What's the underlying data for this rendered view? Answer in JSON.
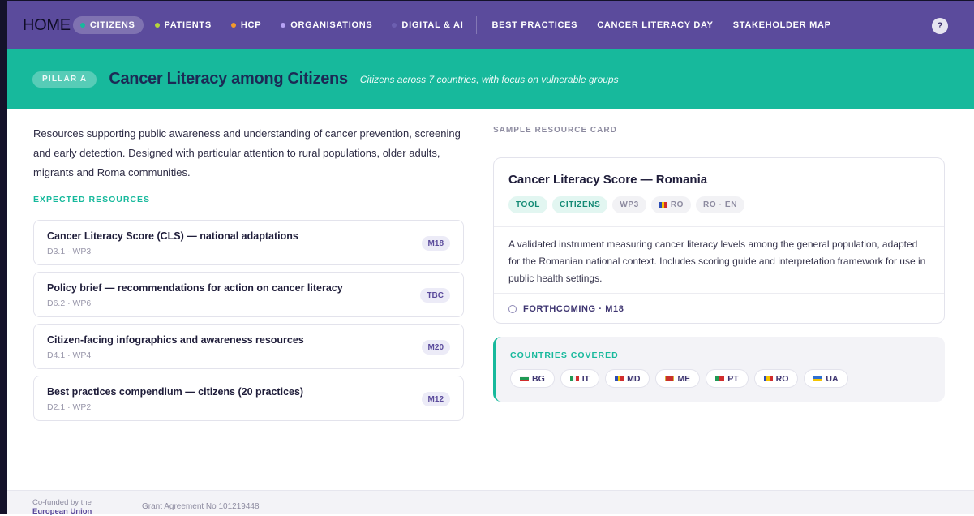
{
  "nav": {
    "home": "HOME",
    "items": [
      {
        "label": "CITIZENS",
        "dot": "#17b99c",
        "active": true
      },
      {
        "label": "PATIENTS",
        "dot": "#b6d53a"
      },
      {
        "label": "HCP",
        "dot": "#f39a2b"
      },
      {
        "label": "ORGANISATIONS",
        "dot": "#b7a3f5"
      },
      {
        "label": "DIGITAL & AI",
        "dot": "#6c5fb0"
      }
    ],
    "links": [
      "BEST PRACTICES",
      "CANCER LITERACY DAY",
      "STAKEHOLDER MAP"
    ],
    "help": "?"
  },
  "hero": {
    "pillar": "PILLAR A",
    "title": "Cancer Literacy among Citizens",
    "subtitle": "Citizens across 7 countries, with focus on vulnerable groups"
  },
  "intro": "Resources supporting public awareness and understanding of cancer prevention, screening and early detection. Designed with particular attention to rural populations, older adults, migrants and Roma communities.",
  "expected_label": "EXPECTED RESOURCES",
  "resources": [
    {
      "title": "Cancer Literacy Score (CLS) — national adaptations",
      "meta": "D3.1 · WP3",
      "badge": "M18"
    },
    {
      "title": "Policy brief — recommendations for action on cancer literacy",
      "meta": "D6.2 · WP6",
      "badge": "TBC"
    },
    {
      "title": "Citizen-facing infographics and awareness resources",
      "meta": "D4.1 · WP4",
      "badge": "M20"
    },
    {
      "title": "Best practices compendium — citizens (20 practices)",
      "meta": "D2.1 · WP2",
      "badge": "M12"
    }
  ],
  "sample": {
    "label": "SAMPLE RESOURCE CARD",
    "title": "Cancer Literacy Score — Romania",
    "tags": {
      "type": "TOOL",
      "audience": "CITIZENS",
      "wp": "WP3",
      "country": "RO",
      "lang": "RO · EN"
    },
    "description": "A validated instrument measuring cancer literacy levels among the general population, adapted for the Romanian national context. Includes scoring guide and interpretation framework for use in public health settings.",
    "status": "FORTHCOMING · M18"
  },
  "countries": {
    "label": "COUNTRIES COVERED",
    "items": [
      "BG",
      "IT",
      "MD",
      "ME",
      "PT",
      "RO",
      "UA"
    ]
  },
  "footer": {
    "cofunded": "Co-funded by the",
    "eu": "European Union",
    "grant": "Grant Agreement No 101219448"
  }
}
